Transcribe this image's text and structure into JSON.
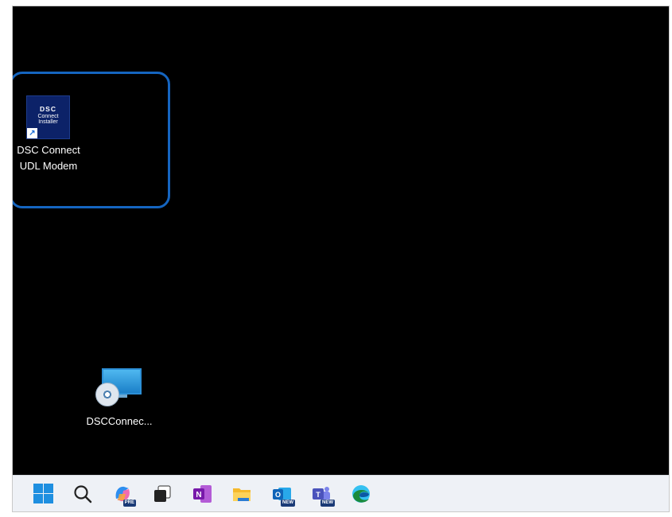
{
  "desktop": {
    "icons": [
      {
        "label_line1": "DSC Connect",
        "label_line2": "UDL Modem",
        "tile_brand": "DSC",
        "tile_line1": "Connect",
        "tile_line2": "Installer"
      },
      {
        "label": "DSCConnec..."
      }
    ]
  },
  "taskbar": {
    "items": [
      {
        "name": "start",
        "icon": "windows-icon"
      },
      {
        "name": "search",
        "icon": "search-icon"
      },
      {
        "name": "copilot",
        "icon": "copilot-icon",
        "badge": "PRE"
      },
      {
        "name": "task-view",
        "icon": "task-view-icon"
      },
      {
        "name": "onenote",
        "icon": "onenote-icon",
        "letter": "N"
      },
      {
        "name": "file-explorer",
        "icon": "folder-icon"
      },
      {
        "name": "outlook",
        "icon": "outlook-icon",
        "letter": "O",
        "badge": "NEW"
      },
      {
        "name": "teams",
        "icon": "teams-icon",
        "letter": "T",
        "badge": "NEW"
      },
      {
        "name": "edge",
        "icon": "edge-icon"
      }
    ]
  },
  "colors": {
    "desktop_bg": "#000000",
    "highlight": "#1565c0",
    "taskbar_bg": "#eef1f6"
  }
}
